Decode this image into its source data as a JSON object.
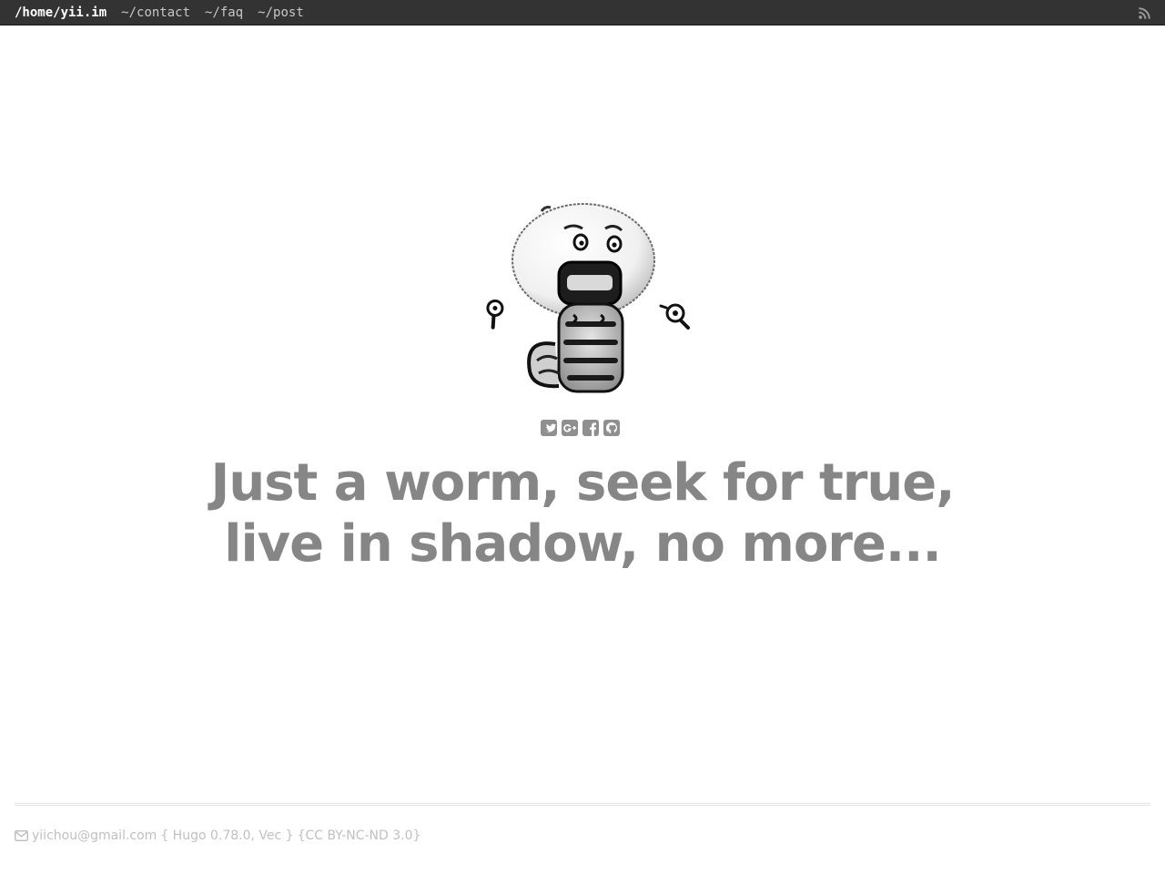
{
  "nav": {
    "home": "/home/yii.im",
    "items": [
      {
        "label": "~/contact"
      },
      {
        "label": "~/faq"
      },
      {
        "label": "~/post"
      }
    ],
    "rss_icon": "rss-icon"
  },
  "hero": {
    "mascot": "worm-mascot-illustration",
    "social_icons": [
      "twitter-icon",
      "google-plus-icon",
      "facebook-icon",
      "github-icon"
    ],
    "tagline_line1": "Just a worm, seek for true,",
    "tagline_line2": "live in shadow, no more..."
  },
  "footer": {
    "mail_icon": "envelope-icon",
    "email": "yiichou@gmail.com",
    "generator": "{ Hugo 0.78.0, Vec }",
    "license": "{CC BY-NC-ND 3.0}"
  },
  "colors": {
    "topbar": "#333333",
    "tagline": "#868686",
    "footer_text": "#c0c0c0",
    "icon_gray": "#8f8f8f"
  }
}
